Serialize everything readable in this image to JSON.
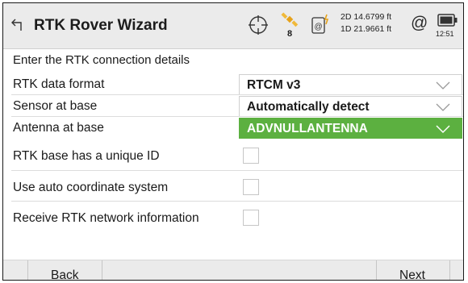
{
  "header": {
    "title": "RTK Rover Wizard",
    "satellite_count": "8",
    "precision_2d": "2D 14.6799 ft",
    "precision_1d": "1D 21.9661 ft",
    "internet_symbol": "@",
    "time": "12:51"
  },
  "form": {
    "section_title": "Enter the RTK connection details",
    "rows": [
      {
        "label": "RTK data format",
        "value": "RTCM v3"
      },
      {
        "label": "Sensor at base",
        "value": "Automatically detect"
      },
      {
        "label": "Antenna at base",
        "value": "ADVNULLANTENNA"
      },
      {
        "label": "RTK base has a unique ID"
      },
      {
        "label": "Use auto coordinate system"
      },
      {
        "label": "Receive RTK network information"
      }
    ]
  },
  "footer": {
    "back_label": "Back",
    "next_label": "Next"
  },
  "colors": {
    "accent_selected": "#5cb040",
    "header_bg": "#ebebeb"
  },
  "icons": [
    "back-arrow-icon",
    "gps-crosshair-icon",
    "satellite-icon",
    "radio-link-icon",
    "internet-at-icon",
    "battery-icon",
    "chevron-down-icon"
  ]
}
